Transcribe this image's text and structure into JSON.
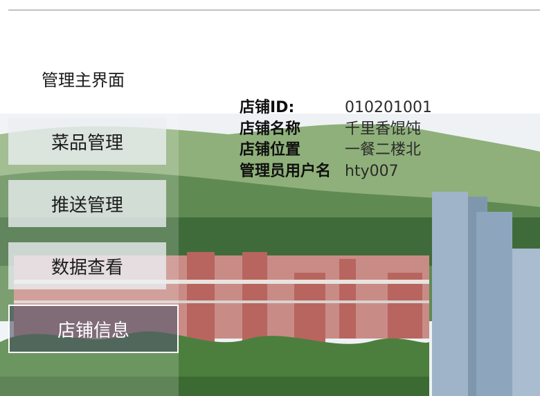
{
  "header": {
    "title": "管理主界面"
  },
  "nav": {
    "items": [
      {
        "label": "菜品管理",
        "active": false
      },
      {
        "label": "推送管理",
        "active": false
      },
      {
        "label": "数据查看",
        "active": false
      },
      {
        "label": "店铺信息",
        "active": true
      }
    ]
  },
  "store_info": {
    "rows": [
      {
        "key": "店铺ID:",
        "value": "010201001"
      },
      {
        "key": "店铺名称",
        "value": "千里香馄饨"
      },
      {
        "key": "店铺位置",
        "value": "一餐二楼北"
      },
      {
        "key": "管理员用户名",
        "value": "hty007"
      }
    ]
  },
  "colors": {
    "active_nav_bg": "#3c425a",
    "nav_bg": "#ebeef2",
    "sky": "#e9eef2",
    "hills": "#4f7a45",
    "buildings": "#b5666a"
  }
}
